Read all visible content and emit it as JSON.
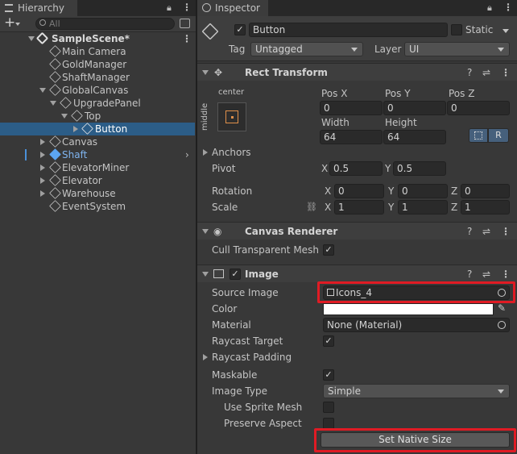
{
  "hierarchy": {
    "tab_label": "Hierarchy",
    "search_placeholder": "All",
    "add_label": "+",
    "scene_name": "SampleScene*",
    "items": [
      {
        "label": "Main Camera"
      },
      {
        "label": "GoldManager"
      },
      {
        "label": "ShaftManager"
      },
      {
        "label": "GlobalCanvas"
      },
      {
        "label": "UpgradePanel"
      },
      {
        "label": "Top"
      },
      {
        "label": "Button"
      },
      {
        "label": "Canvas"
      },
      {
        "label": "Shaft"
      },
      {
        "label": "ElevatorMiner"
      },
      {
        "label": "Elevator"
      },
      {
        "label": "Warehouse"
      },
      {
        "label": "EventSystem"
      }
    ]
  },
  "inspector": {
    "tab_label": "Inspector",
    "object_name": "Button",
    "static_label": "Static",
    "tag_label": "Tag",
    "tag_value": "Untagged",
    "layer_label": "Layer",
    "layer_value": "UI",
    "rect_transform": {
      "title": "Rect Transform",
      "anchor_h": "center",
      "anchor_v": "middle",
      "pos_x_label": "Pos X",
      "pos_x": "0",
      "pos_y_label": "Pos Y",
      "pos_y": "0",
      "pos_z_label": "Pos Z",
      "pos_z": "0",
      "width_label": "Width",
      "width": "64",
      "height_label": "Height",
      "height": "64",
      "r_button": "R",
      "anchors_label": "Anchors",
      "pivot_label": "Pivot",
      "pivot_x": "0.5",
      "pivot_y": "0.5",
      "rotation_label": "Rotation",
      "rot_x": "0",
      "rot_y": "0",
      "rot_z": "0",
      "scale_label": "Scale",
      "scale_x": "1",
      "scale_y": "1",
      "scale_z": "1",
      "x": "X",
      "y": "Y",
      "z": "Z"
    },
    "canvas_renderer": {
      "title": "Canvas Renderer",
      "cull_label": "Cull Transparent Mesh"
    },
    "image": {
      "title": "Image",
      "source_label": "Source Image",
      "source_value": "Icons_4",
      "color_label": "Color",
      "color_value": "#ffffff",
      "material_label": "Material",
      "material_value": "None (Material)",
      "raycast_target_label": "Raycast Target",
      "raycast_padding_label": "Raycast Padding",
      "maskable_label": "Maskable",
      "image_type_label": "Image Type",
      "image_type_value": "Simple",
      "use_sprite_mesh_label": "Use Sprite Mesh",
      "preserve_aspect_label": "Preserve Aspect",
      "native_size_button": "Set Native Size"
    }
  },
  "colors": {
    "selection": "#2c5d87",
    "highlight": "#e01b24",
    "prefab_blue": "#7fb4ef"
  }
}
